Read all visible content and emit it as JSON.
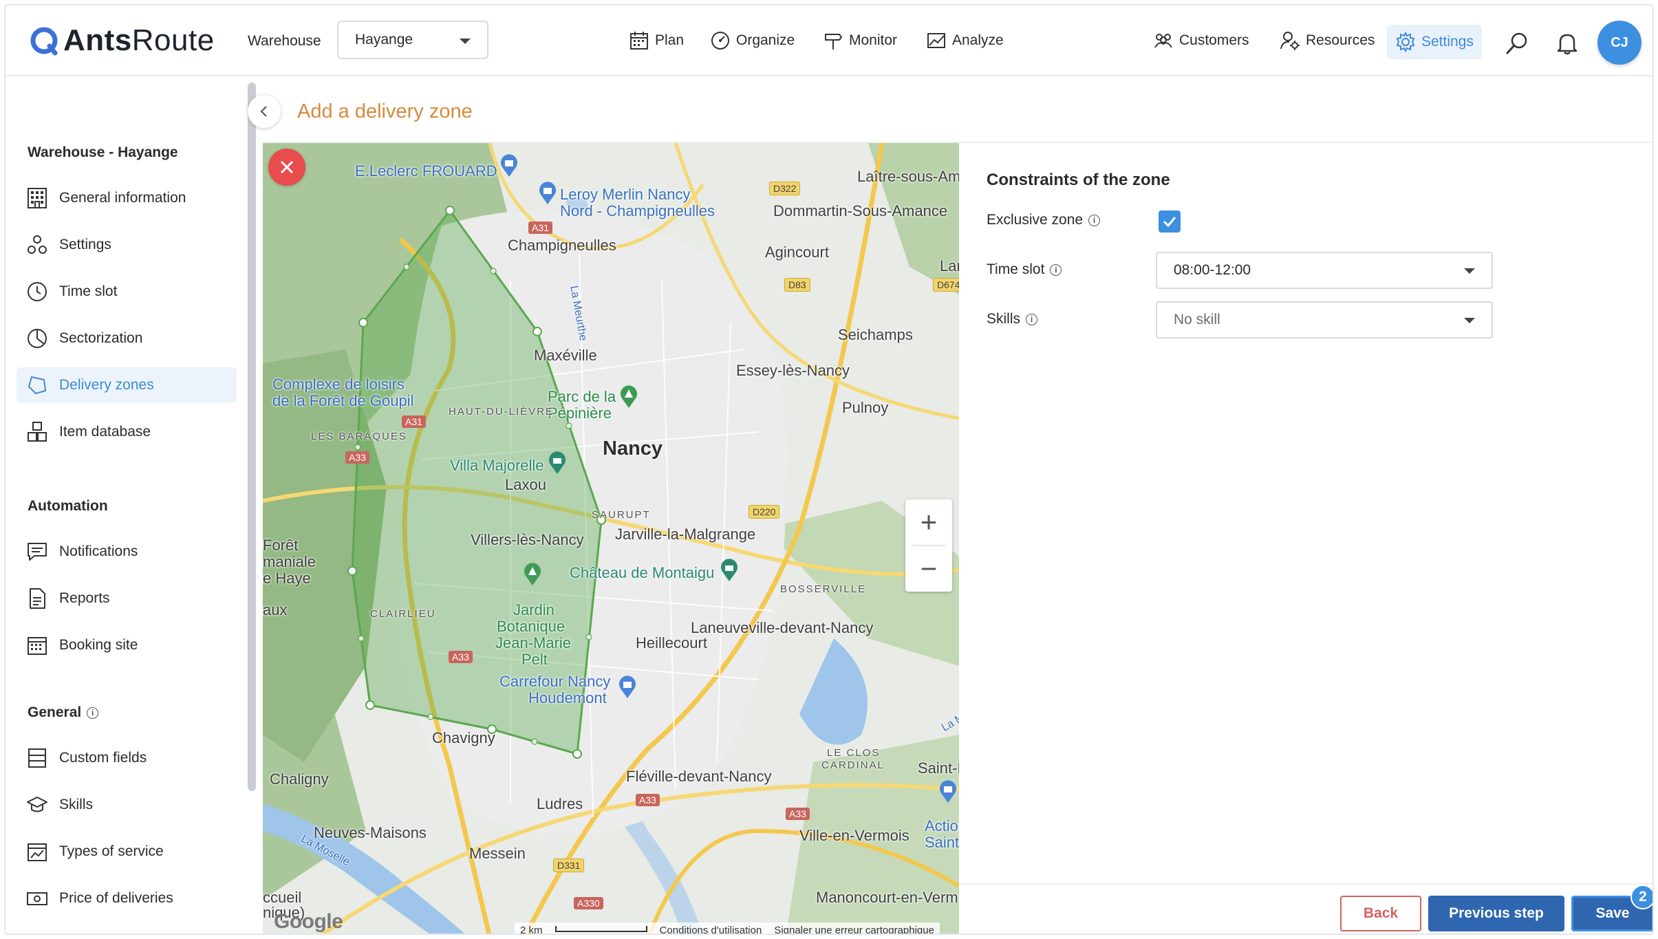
{
  "app": {
    "brand_bold": "Ants",
    "brand_light": "Route"
  },
  "header": {
    "warehouse_label": "Warehouse",
    "warehouse_value": "Hayange",
    "nav": {
      "plan": "Plan",
      "organize": "Organize",
      "monitor": "Monitor",
      "analyze": "Analyze",
      "customers": "Customers",
      "resources": "Resources",
      "settings": "Settings"
    },
    "avatar_initials": "CJ"
  },
  "sidebar": {
    "section_warehouse": "Warehouse - Hayange",
    "section_automation": "Automation",
    "section_general": "General",
    "items": {
      "general_information": "General information",
      "settings": "Settings",
      "time_slot": "Time slot",
      "sectorization": "Sectorization",
      "delivery_zones": "Delivery zones",
      "item_database": "Item database",
      "notifications": "Notifications",
      "reports": "Reports",
      "booking_site": "Booking site",
      "custom_fields": "Custom fields",
      "skills": "Skills",
      "types_of_service": "Types of service",
      "price_of_deliveries": "Price of deliveries"
    },
    "active_item": "delivery_zones"
  },
  "main": {
    "title": "Add a delivery zone"
  },
  "map": {
    "labels": {
      "eleclerc": "E.Leclerc FROUARD",
      "leroy": "Leroy Merlin Nancy",
      "leroy2": "Nord - Champigneulles",
      "laitre": "Laître-sous-Am",
      "dommartin": "Dommartin-Sous-Amance",
      "champigneulles": "Champigneulles",
      "agincourt": "Agincourt",
      "lar": "Lar",
      "maxeville": "Maxéville",
      "seichamps": "Seichamps",
      "essey": "Essey-lès-Nancy",
      "pulnoy": "Pulnoy",
      "complexe1": "Complexe de loisirs",
      "complexe2": "de la Forêt de Goupil",
      "parc1": "Parc de la",
      "parc2": "Pépinière",
      "haut_du_lievre": "HAUT-DU-LIÈVRE",
      "les_baraques": "LES BARAQUES",
      "nancy": "Nancy",
      "villa_majorelle": "Villa Majorelle",
      "laxou": "Laxou",
      "saurupt": "SAURUPT",
      "villers": "Villers-lès-Nancy",
      "jarville": "Jarville-la-Malgrange",
      "foret1": "Forêt",
      "foret2": "maniale",
      "foret3": "e Haye",
      "aux": "aux",
      "chateau": "Château de Montaigu",
      "bosserville": "BOSSERVILLE",
      "clairlieu": "CLAIRLIEU",
      "jardin1": "Jardin",
      "jardin2": "Botanique",
      "jardin3": "Jean-Marie",
      "jardin4": "Pelt",
      "laneuveville": "Laneuveville-devant-Nancy",
      "heillecourt": "Heillecourt",
      "carrefour1": "Carrefour Nancy",
      "carrefour2": "Houdemont",
      "chavigny": "Chavigny",
      "le_clos1": "LE CLOS",
      "le_clos2": "CARDINAL",
      "saint_n": "Saint-N",
      "chaligny": "Chaligny",
      "fleville": "Fléville-devant-Nancy",
      "ludres": "Ludres",
      "neuves": "Neuves-Maisons",
      "action1": "Action",
      "action2": "Saint-",
      "villeen": "Ville-en-Vermois",
      "messein": "Messein",
      "la_moselle": "La Moselle",
      "la_meurthe": "La Meurthe",
      "la_m": "La M",
      "manoncourt": "Manoncourt-en-Verm",
      "accueil1": "ccueil",
      "accueil2": "nique)",
      "google": "Google"
    },
    "roads": {
      "a31_top": "A31",
      "d322": "D322",
      "d83": "D83",
      "d674": "D674",
      "a31": "A31",
      "a33_left": "A33",
      "d220": "D220",
      "a33_mid": "A33",
      "a33_bot1": "A33",
      "a33_bot2": "A33",
      "d331": "D331",
      "a330": "A330"
    },
    "footer": {
      "scale": "2 km",
      "terms": "Conditions d'utilisation",
      "report": "Signaler une erreur cartographique"
    },
    "zoom_in": "+",
    "zoom_out": "−"
  },
  "constraints": {
    "title": "Constraints of the zone",
    "exclusive_label": "Exclusive zone",
    "exclusive_checked": true,
    "time_slot_label": "Time slot",
    "time_slot_value": "08:00-12:00",
    "skills_label": "Skills",
    "skills_placeholder": "No skill",
    "info_glyph": "i"
  },
  "footer": {
    "back": "Back",
    "previous": "Previous step",
    "save": "Save",
    "badge": "2"
  },
  "colors": {
    "accent": "#3d8fe0",
    "title_orange": "#d88a3c",
    "primary_button": "#2f66b0",
    "back_red": "#d56262",
    "zone_green": "#5aa84e"
  }
}
